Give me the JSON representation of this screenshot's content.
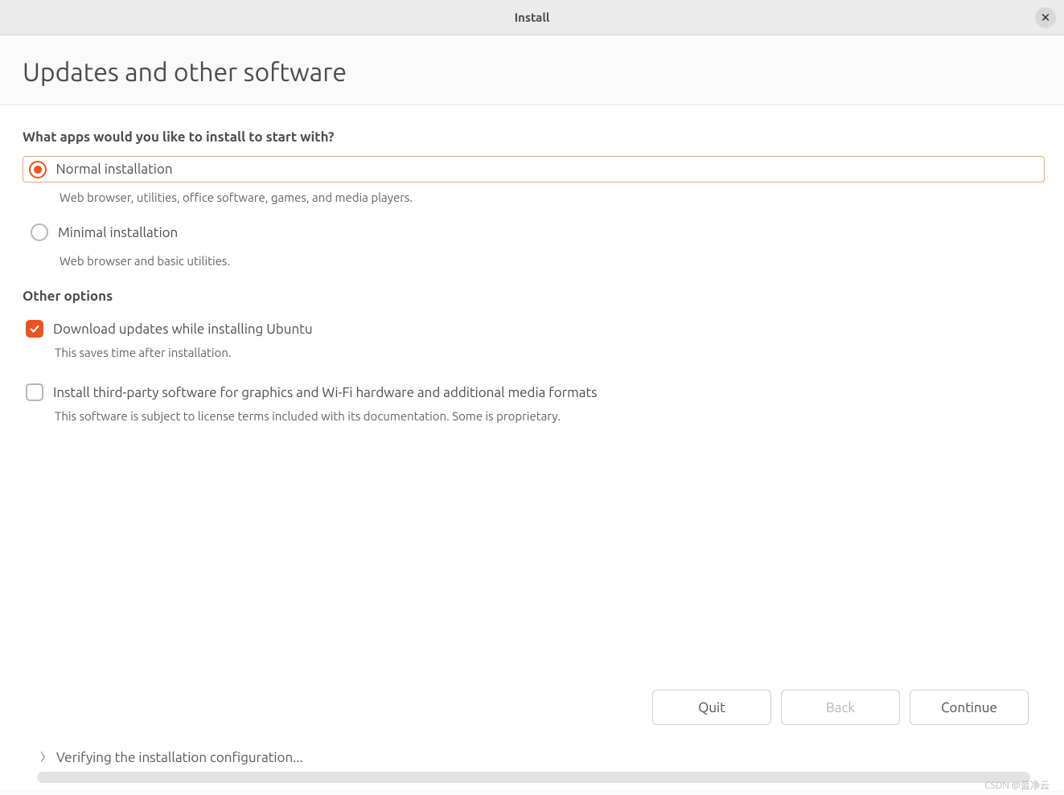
{
  "titlebar": {
    "title": "Install"
  },
  "page_title": "Updates and other software",
  "question": "What apps would you like to install to start with?",
  "install_type": {
    "normal": {
      "label": "Normal installation",
      "desc": "Web browser, utilities, office software, games, and media players.",
      "selected": true
    },
    "minimal": {
      "label": "Minimal installation",
      "desc": "Web browser and basic utilities.",
      "selected": false
    }
  },
  "other_options_heading": "Other options",
  "options": {
    "download_updates": {
      "label": "Download updates while installing Ubuntu",
      "desc": "This saves time after installation.",
      "checked": true
    },
    "third_party": {
      "label": "Install third-party software for graphics and Wi-Fi hardware and additional media formats",
      "desc": "This software is subject to license terms included with its documentation. Some is proprietary.",
      "checked": false
    }
  },
  "buttons": {
    "quit": "Quit",
    "back": "Back",
    "continue": "Continue"
  },
  "expander": {
    "label": "Verifying the installation configuration..."
  },
  "watermark": "CSDN @蓝净云"
}
